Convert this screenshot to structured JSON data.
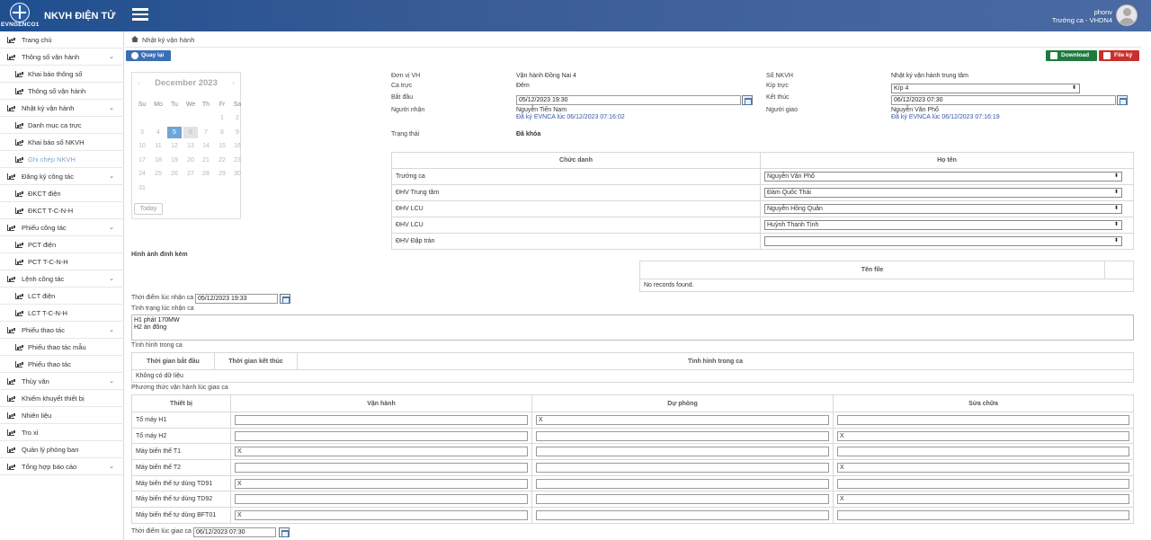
{
  "header": {
    "logo_text": "EVNGENCO1",
    "app_title": "NKVH ĐIỆN TỬ",
    "username": "phonv",
    "role": "Trưởng ca - VHDN4"
  },
  "sidebar": {
    "items": [
      {
        "label": "Trang chủ",
        "level": 0,
        "chevron": false
      },
      {
        "label": "Thông số vận hành",
        "level": 0,
        "chevron": true
      },
      {
        "label": "Khai báo thông số",
        "level": 1
      },
      {
        "label": "Thông số vận hành",
        "level": 1
      },
      {
        "label": "Nhật ký vận hành",
        "level": 0,
        "chevron": true
      },
      {
        "label": "Danh mục ca trực",
        "level": 1
      },
      {
        "label": "Khai báo sổ NKVH",
        "level": 1
      },
      {
        "label": "Ghi chép NKVH",
        "level": 1,
        "active": true
      },
      {
        "label": "Đăng ký công tác",
        "level": 0,
        "chevron": true
      },
      {
        "label": "ĐKCT điện",
        "level": 1
      },
      {
        "label": "ĐKCT T-C-N-H",
        "level": 1
      },
      {
        "label": "Phiếu công tác",
        "level": 0,
        "chevron": true
      },
      {
        "label": "PCT điện",
        "level": 1
      },
      {
        "label": "PCT T-C-N-H",
        "level": 1
      },
      {
        "label": "Lệnh công tác",
        "level": 0,
        "chevron": true
      },
      {
        "label": "LCT điện",
        "level": 1
      },
      {
        "label": "LCT T-C-N-H",
        "level": 1
      },
      {
        "label": "Phiếu thao tác",
        "level": 0,
        "chevron": true
      },
      {
        "label": "Phiếu thao tác mẫu",
        "level": 1
      },
      {
        "label": "Phiếu thao tác",
        "level": 1
      },
      {
        "label": "Thủy văn",
        "level": 0,
        "chevron": true
      },
      {
        "label": "Khiếm khuyết thiết bị",
        "level": 0,
        "chevron": false
      },
      {
        "label": "Nhiên liệu",
        "level": 0,
        "chevron": false
      },
      {
        "label": "Tro xỉ",
        "level": 0,
        "chevron": false
      },
      {
        "label": "Quản lý phòng ban",
        "level": 0,
        "chevron": false
      },
      {
        "label": "Tổng hợp báo cáo",
        "level": 0,
        "chevron": true
      }
    ]
  },
  "breadcrumb": {
    "current": "Nhật ký vận hành"
  },
  "toolbar": {
    "back": "Quay lại",
    "download": "Download",
    "sign": "File ký"
  },
  "calendar": {
    "month_label": "December 2023",
    "weekdays": [
      "Su",
      "Mo",
      "Tu",
      "We",
      "Th",
      "Fr",
      "Sa"
    ],
    "selected_day": 5,
    "today_label": "Today"
  },
  "form": {
    "don_vi_label": "Đơn vị VH",
    "don_vi_value": "Vận hành Đồng Nai 4",
    "so_nkvh_label": "Sổ NKVH",
    "so_nkvh_value": "Nhật ký vận hành trung tâm",
    "ca_truc_label": "Ca trực",
    "ca_truc_value": "Đêm",
    "kip_truc_label": "Kíp trực",
    "kip_truc_value": "Kíp 4",
    "bat_dau_label": "Bắt đầu",
    "bat_dau_value": "05/12/2023 19:30",
    "ket_thuc_label": "Kết thúc",
    "ket_thuc_value": "06/12/2023 07:30",
    "nguoi_nhan_label": "Người nhận",
    "nguoi_nhan_value": "Nguyễn Tiến Nam",
    "nguoi_nhan_sign": "Đã ký EVNCA lúc 06/12/2023 07:16:02",
    "nguoi_giao_label": "Người giao",
    "nguoi_giao_value": "Nguyễn Văn Phổ",
    "nguoi_giao_sign": "Đã ký EVNCA lúc 06/12/2023 07:16:19",
    "trang_thai_label": "Trạng thái",
    "trang_thai_value": "Đã khóa"
  },
  "staff_table": {
    "headers": [
      "Chức danh",
      "Họ tên"
    ],
    "rows": [
      {
        "role": "Trưởng ca",
        "name": "Nguyễn Văn Phổ"
      },
      {
        "role": "ĐHV Trung tâm",
        "name": "Đàm Quốc Thái"
      },
      {
        "role": "ĐHV LCU",
        "name": "Nguyễn Hồng Quân"
      },
      {
        "role": "ĐHV LCU",
        "name": "Huỳnh Thanh Tịnh"
      },
      {
        "role": "ĐHV Đập tràn",
        "name": ""
      }
    ]
  },
  "attachments": {
    "title": "Hình ảnh đính kèm",
    "col_header": "Tên file",
    "empty": "No records found."
  },
  "receive": {
    "time_label": "Thời điểm lúc nhận ca",
    "time_value": "05/12/2023 19:33",
    "status_label": "Tình trạng lúc nhận ca",
    "status_lines": [
      "H1 phát 170MW",
      "H2 ản đông"
    ]
  },
  "shift": {
    "title": "Tình hình trong ca",
    "headers": [
      "Thời gian bắt đầu",
      "Thời gian kết thúc",
      "Tình hình trong ca"
    ],
    "empty": "Không có dữ liệu"
  },
  "handover": {
    "title": "Phương thức vận hành lúc giao ca",
    "headers": [
      "Thiết bị",
      "Vận hành",
      "Dự phòng",
      "Sửa chữa"
    ],
    "rows": [
      {
        "device": "Tổ máy H1",
        "van_hanh": "",
        "du_phong": "X",
        "sua_chua": ""
      },
      {
        "device": "Tổ máy H2",
        "van_hanh": "",
        "du_phong": "",
        "sua_chua": "X"
      },
      {
        "device": "Máy biến thế T1",
        "van_hanh": "X",
        "du_phong": "",
        "sua_chua": ""
      },
      {
        "device": "Máy biến thế T2",
        "van_hanh": "",
        "du_phong": "",
        "sua_chua": "X"
      },
      {
        "device": "Máy biến thế tự dùng TD91",
        "van_hanh": "X",
        "du_phong": "",
        "sua_chua": ""
      },
      {
        "device": "Máy biến thế tự dùng TD92",
        "van_hanh": "",
        "du_phong": "",
        "sua_chua": "X"
      },
      {
        "device": "Máy biến thế tự dùng BFT01",
        "van_hanh": "X",
        "du_phong": "",
        "sua_chua": ""
      }
    ]
  },
  "giao": {
    "time_label": "Thời điểm lúc giao ca",
    "time_value": "06/12/2023 07:30"
  }
}
